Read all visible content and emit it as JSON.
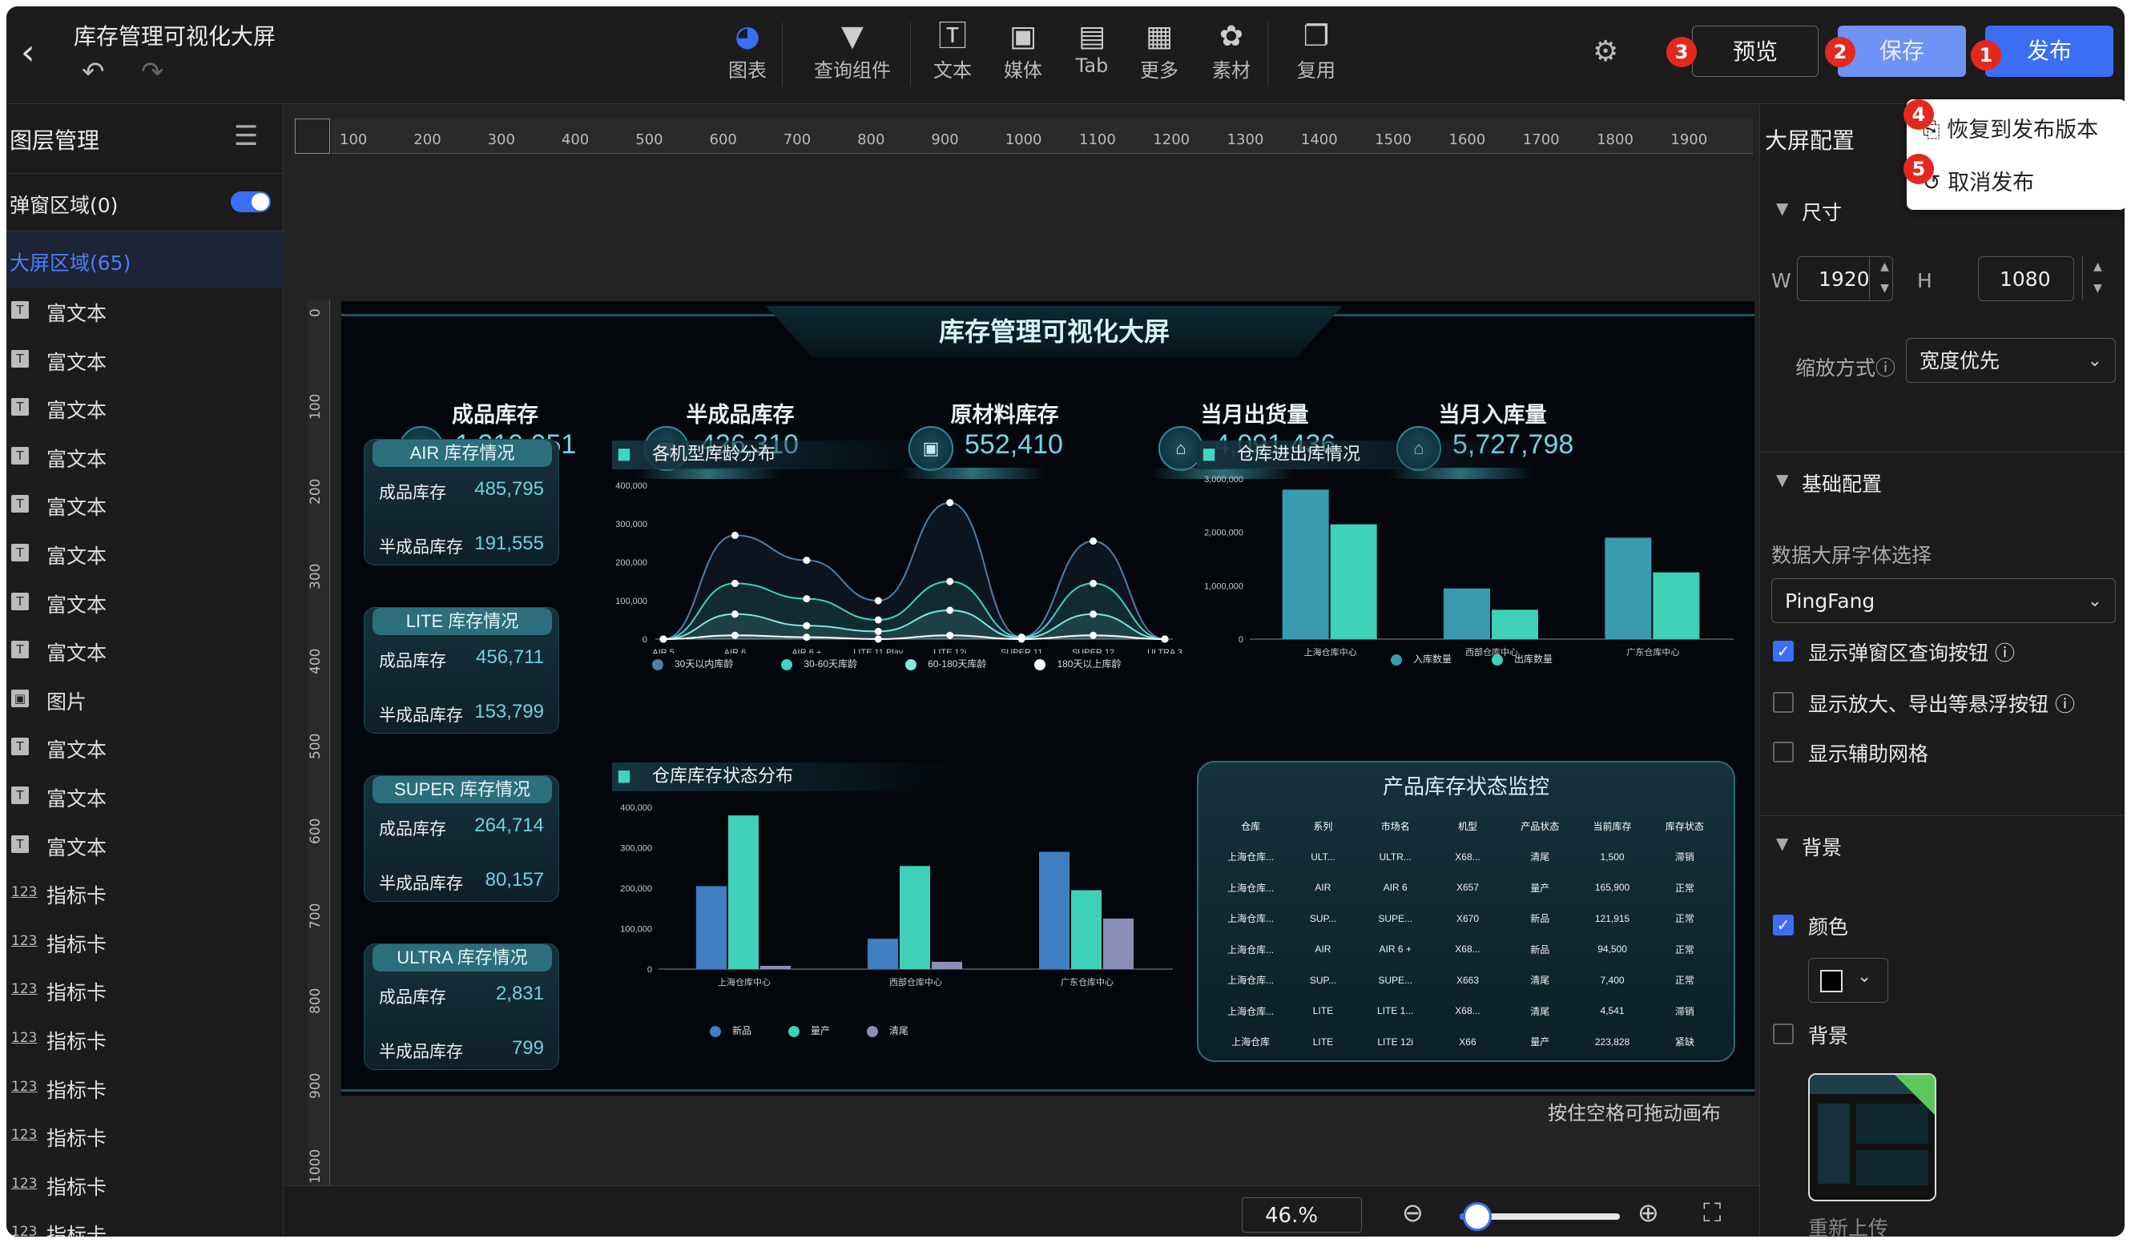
{
  "app": {
    "title": "库存管理可视化大屏"
  },
  "toolbar": {
    "tools": [
      "图表",
      "查询组件",
      "文本",
      "媒体",
      "Tab",
      "更多",
      "素材",
      "复用"
    ],
    "preview": "预览",
    "save": "保存",
    "publish": "发布"
  },
  "badges": [
    "1",
    "2",
    "3",
    "4",
    "5"
  ],
  "dropdown": {
    "restore": "恢复到发布版本",
    "cancel": "取消发布"
  },
  "left_panel": {
    "title": "图层管理",
    "popup_area": "弹窗区域(0)",
    "screen_area": "大屏区域(65)",
    "layers": [
      {
        "icon": "T",
        "name": "富文本"
      },
      {
        "icon": "T",
        "name": "富文本"
      },
      {
        "icon": "T",
        "name": "富文本"
      },
      {
        "icon": "T",
        "name": "富文本"
      },
      {
        "icon": "T",
        "name": "富文本"
      },
      {
        "icon": "T",
        "name": "富文本"
      },
      {
        "icon": "T",
        "name": "富文本"
      },
      {
        "icon": "T",
        "name": "富文本"
      },
      {
        "icon": "img",
        "name": "图片"
      },
      {
        "icon": "T",
        "name": "富文本"
      },
      {
        "icon": "T",
        "name": "富文本"
      },
      {
        "icon": "T",
        "name": "富文本"
      },
      {
        "icon": "123",
        "name": "指标卡"
      },
      {
        "icon": "123",
        "name": "指标卡"
      },
      {
        "icon": "123",
        "name": "指标卡"
      },
      {
        "icon": "123",
        "name": "指标卡"
      },
      {
        "icon": "123",
        "name": "指标卡"
      },
      {
        "icon": "123",
        "name": "指标卡"
      },
      {
        "icon": "123",
        "name": "指标卡"
      },
      {
        "icon": "123",
        "name": "指标卡"
      }
    ]
  },
  "ruler": {
    "h": [
      "100",
      "200",
      "300",
      "400",
      "500",
      "600",
      "700",
      "800",
      "900",
      "1000",
      "1100",
      "1200",
      "1300",
      "1400",
      "1500",
      "1600",
      "1700",
      "1800",
      "1900"
    ],
    "v": [
      "0",
      "100",
      "200",
      "300",
      "400",
      "500",
      "600",
      "700",
      "800",
      "900",
      "1000"
    ]
  },
  "canvas": {
    "hint": "按住空格可拖动画布",
    "zoom": "46.%",
    "zoom_fraction": 0.1
  },
  "dashboard": {
    "title": "库存管理可视化大屏",
    "kpis": [
      {
        "label": "成品库存",
        "value": "1,210,051",
        "icon": "box-icon"
      },
      {
        "label": "半成品库存",
        "value": "426,310",
        "icon": "parts-icon"
      },
      {
        "label": "原材料库存",
        "value": "552,410",
        "icon": "material-icon"
      },
      {
        "label": "当月出货量",
        "value": "4,091,436",
        "icon": "warehouse-out-icon"
      },
      {
        "label": "当月入库量",
        "value": "5,727,798",
        "icon": "warehouse-in-icon"
      }
    ],
    "cards": [
      {
        "title": "AIR 库存情况",
        "r1": "成品库存",
        "v1": "485,795",
        "r2": "半成品库存",
        "v2": "191,555"
      },
      {
        "title": "LITE 库存情况",
        "r1": "成品库存",
        "v1": "456,711",
        "r2": "半成品库存",
        "v2": "153,799"
      },
      {
        "title": "SUPER 库存情况",
        "r1": "成品库存",
        "v1": "264,714",
        "r2": "半成品库存",
        "v2": "80,157"
      },
      {
        "title": "ULTRA 库存情况",
        "r1": "成品库存",
        "v1": "2,831",
        "r2": "半成品库存",
        "v2": "799"
      }
    ],
    "sections": {
      "age": "各机型库龄分布",
      "inout": "仓库进出库情况",
      "status": "仓库库存状态分布",
      "monitor": "产品库存状态监控"
    },
    "monitor_headers": [
      "仓库",
      "系列",
      "市场名",
      "机型",
      "产品状态",
      "当前库存",
      "库存状态"
    ],
    "monitor_rows": [
      [
        "上海仓库...",
        "ULT...",
        "ULTR...",
        "X68...",
        "清尾",
        "1,500",
        "滞销"
      ],
      [
        "上海仓库...",
        "AIR",
        "AIR 6",
        "X657",
        "量产",
        "165,900",
        "正常"
      ],
      [
        "上海仓库...",
        "SUP...",
        "SUPE...",
        "X670",
        "新品",
        "121,915",
        "正常"
      ],
      [
        "上海仓库...",
        "AIR",
        "AIR 6 +",
        "X68...",
        "新品",
        "94,500",
        "正常"
      ],
      [
        "上海仓库...",
        "SUP...",
        "SUPE...",
        "X663",
        "清尾",
        "7,400",
        "正常"
      ],
      [
        "上海仓库...",
        "LITE",
        "LITE 1...",
        "X68...",
        "清尾",
        "4,541",
        "滞销"
      ],
      [
        "上海仓库",
        "LITE",
        "LITE 12i",
        "X66",
        "量产",
        "223,828",
        "紧缺"
      ]
    ]
  },
  "chart_data": [
    {
      "type": "line",
      "title": "各机型库龄分布",
      "categories": [
        "AIR 5",
        "AIR 6",
        "AIR 6 +",
        "LITE 11 Play",
        "LITE 12i",
        "SUPER 11",
        "SUPER 12",
        "ULTRA 3"
      ],
      "ylim": [
        0,
        400000
      ],
      "yticks": [
        "0",
        "100,000",
        "200,000",
        "300,000",
        "400,000"
      ],
      "series": [
        {
          "name": "30天以内库龄",
          "values": [
            0,
            270000,
            205000,
            100000,
            355000,
            5000,
            255000,
            0
          ],
          "color": "#4f7ea8"
        },
        {
          "name": "30-60天库龄",
          "values": [
            0,
            145000,
            105000,
            50000,
            150000,
            5000,
            145000,
            0
          ],
          "color": "#3fd1c2"
        },
        {
          "name": "60-180天库龄",
          "values": [
            0,
            65000,
            35000,
            20000,
            75000,
            3000,
            65000,
            0
          ],
          "color": "#7fe6e0"
        },
        {
          "name": "180天以上库龄",
          "values": [
            0,
            10000,
            5000,
            0,
            10000,
            0,
            10000,
            0
          ],
          "color": "#ffffff"
        }
      ]
    },
    {
      "type": "bar",
      "title": "仓库进出库情况",
      "categories": [
        "上海仓库中心",
        "西部仓库中心",
        "广东仓库中心"
      ],
      "ylim": [
        0,
        3000000
      ],
      "yticks": [
        "0",
        "1,000,000",
        "2,000,000",
        "3,000,000"
      ],
      "series": [
        {
          "name": "入库数量",
          "values": [
            2800000,
            950000,
            1900000
          ],
          "color": "#3a9ab0"
        },
        {
          "name": "出库数量",
          "values": [
            2150000,
            550000,
            1250000
          ],
          "color": "#3fd1b8"
        }
      ]
    },
    {
      "type": "bar",
      "title": "仓库库存状态分布",
      "categories": [
        "上海仓库中心",
        "西部仓库中心",
        "广东仓库中心"
      ],
      "ylim": [
        0,
        400000
      ],
      "yticks": [
        "0",
        "100,000",
        "200,000",
        "300,000",
        "400,000"
      ],
      "series": [
        {
          "name": "新品",
          "values": [
            205000,
            75000,
            290000
          ],
          "color": "#3f7fc1"
        },
        {
          "name": "量产",
          "values": [
            380000,
            255000,
            195000
          ],
          "color": "#3fd1b8"
        },
        {
          "name": "清尾",
          "values": [
            8000,
            18000,
            125000
          ],
          "color": "#8b8fb8"
        }
      ]
    }
  ],
  "right_panel": {
    "title": "大屏配置",
    "size_section": "尺寸",
    "w_label": "W",
    "w_value": "1920",
    "h_label": "H",
    "h_value": "1080",
    "scale_label": "缩放方式",
    "scale_value": "宽度优先",
    "basic_section": "基础配置",
    "font_label": "数据大屏字体选择",
    "font_value": "PingFang",
    "check_popup_query": "显示弹窗区查询按钮",
    "check_float": "显示放大、导出等悬浮按钮",
    "check_grid": "显示辅助网格",
    "bg_section": "背景",
    "color_label": "颜色",
    "bg_label": "背景",
    "reupload": "重新上传"
  },
  "colors": {
    "accent": "#3b6ef5",
    "badge": "#e5281f",
    "teal": "#3fd1c2"
  }
}
